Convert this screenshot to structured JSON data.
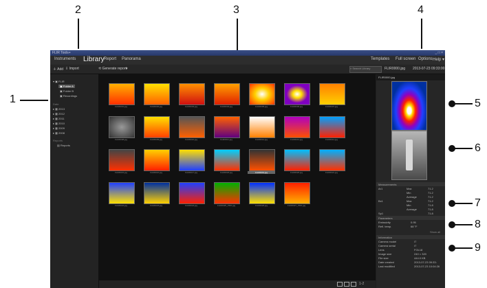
{
  "callouts": [
    "1",
    "2",
    "3",
    "4",
    "5",
    "6",
    "7",
    "8",
    "9"
  ],
  "window": {
    "title": "FLIR Tools+",
    "controls": "_ □ ×"
  },
  "menu": {
    "instruments": "Instruments",
    "library": "Library",
    "report": "Report",
    "panorama": "Panorama",
    "templates": "Templates",
    "fullscreen": "Full screen",
    "options": "Options",
    "help": "Help ▾"
  },
  "toolbar": {
    "add": "Add",
    "import": "Import",
    "generate_report": "Generate report",
    "dropdown": "▾",
    "search_placeholder": "Search Library",
    "selected_file": "FLIR0000.jpg",
    "selected_date": "2013-07-23 09:33:00"
  },
  "sidebar": {
    "root": "FLIR",
    "folders": [
      "Folder A",
      "Folder B",
      "Recordings"
    ],
    "years_label": "Date",
    "years": [
      "2013",
      "2012",
      "2011",
      "2010",
      "2009",
      "2008"
    ],
    "reports_label": "Reports",
    "reports_item": "Reports"
  },
  "thumbnails": [
    {
      "name": "FLIR0001.jpg"
    },
    {
      "name": "FLIR0002.jpg"
    },
    {
      "name": "FLIR0003.jpg"
    },
    {
      "name": "FLIR0004.jpg"
    },
    {
      "name": "FLIR0005.jpg"
    },
    {
      "name": "FLIR0006.jpg"
    },
    {
      "name": "FLIR0007.jpg"
    },
    {
      "name": "FLIR0008.jpg"
    },
    {
      "name": "FLIR0009.jpg"
    },
    {
      "name": "FLIR0010.jpg"
    },
    {
      "name": "FLIR0011.jpg"
    },
    {
      "name": "FLIR0012.jpg"
    },
    {
      "name": "FLIR0013.jpg"
    },
    {
      "name": "FLIR0014.jpg"
    },
    {
      "name": "FLIR0015.jpg"
    },
    {
      "name": "FLIR0016.jpg"
    },
    {
      "name": "FLIR0017.jpg"
    },
    {
      "name": "FLIR0018.jpg"
    },
    {
      "name": "FLIR0019.jpg"
    },
    {
      "name": "FLIR0020.jpg"
    },
    {
      "name": "FLIR0021.jpg"
    },
    {
      "name": "FLIR0022.jpg"
    },
    {
      "name": "FLIR0023.jpg"
    },
    {
      "name": "FLIR0024.jpg"
    },
    {
      "name": "FLIR0025_PRO.jpg"
    },
    {
      "name": "FLIR0026.jpg"
    },
    {
      "name": "FLIR0027_PRO.jpg"
    }
  ],
  "gridbar": {
    "view_label": "1-2"
  },
  "measurements": {
    "title": "Measurements",
    "rows": [
      {
        "label": "Ar1",
        "stat": "Max",
        "value": "71.2"
      },
      {
        "label": "",
        "stat": "Min",
        "value": "71.2"
      },
      {
        "label": "",
        "stat": "Average",
        "value": "71.2"
      },
      {
        "label": "Bx1",
        "stat": "Max",
        "value": "71.2"
      },
      {
        "label": "",
        "stat": "Min",
        "value": "71.8"
      },
      {
        "label": "",
        "stat": "Average",
        "value": "71.8"
      },
      {
        "label": "Sp1",
        "stat": "",
        "value": "71.8"
      }
    ]
  },
  "parameters": {
    "title": "Parameters",
    "rows": [
      {
        "label": "Emissivity",
        "value": "0.95"
      },
      {
        "label": "Refl. temp.",
        "value": "68 °F"
      }
    ],
    "more": "Show all"
  },
  "information": {
    "title": "Information",
    "rows": [
      {
        "label": "Camera model",
        "value": "I7"
      },
      {
        "label": "Camera serial",
        "value": "I7"
      },
      {
        "label": "Lens",
        "value": "FOL18"
      },
      {
        "label": "Image size",
        "value": "240 × 320"
      },
      {
        "label": "File size",
        "value": "444.0 KB"
      },
      {
        "label": "Date created",
        "value": "2013-07-23 09:33:"
      },
      {
        "label": "Last modified",
        "value": "2013-07-23 10:04:26"
      }
    ]
  }
}
